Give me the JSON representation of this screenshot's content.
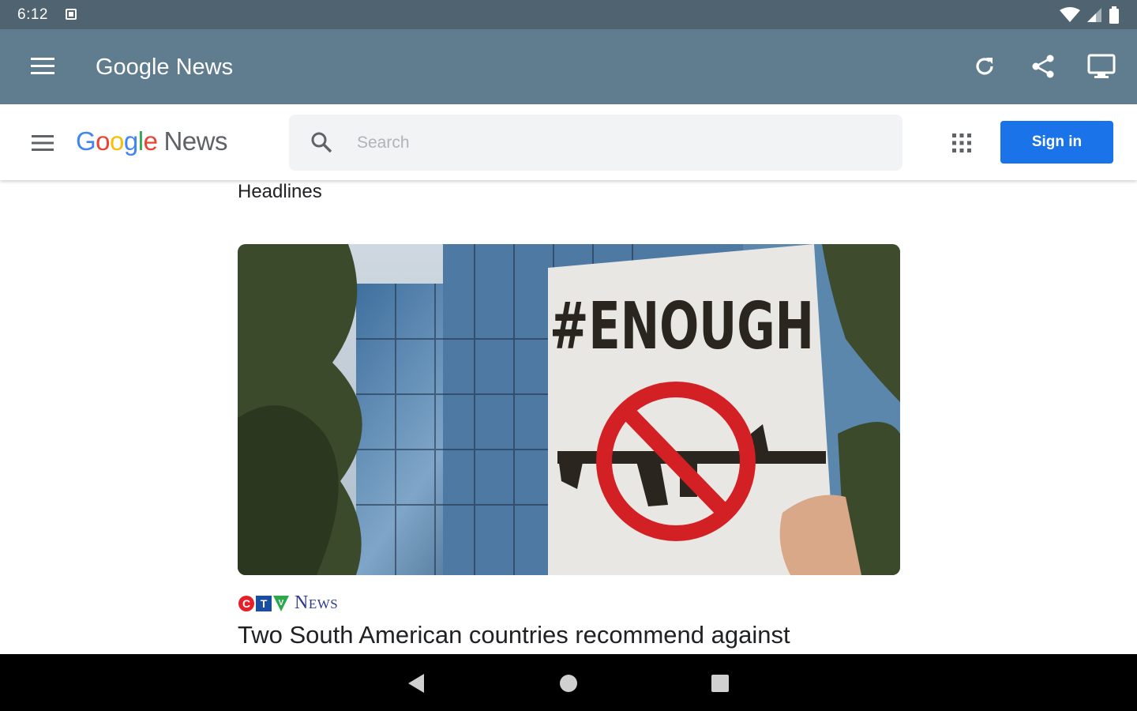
{
  "status_bar": {
    "time": "6:12"
  },
  "app_bar": {
    "title": "Google News"
  },
  "gn_header": {
    "logo_word": [
      "G",
      "o",
      "o",
      "g",
      "l",
      "e"
    ],
    "logo_colors": [
      "#4285f4",
      "#ea4335",
      "#fbbc05",
      "#4285f4",
      "#34a853",
      "#ea4335"
    ],
    "logo_news": "News",
    "search_placeholder": "Search",
    "sign_in_label": "Sign in"
  },
  "main": {
    "section_title": "Headlines",
    "article": {
      "image_sign_text": "#ENOUGH",
      "source_letters": [
        "C",
        "T",
        "V"
      ],
      "source_colors": [
        "#e4202a",
        "#1a4ea2",
        "#2aa84a"
      ],
      "source_news": "News",
      "headline": "Two South American countries recommend against"
    }
  },
  "colors": {
    "status_bar": "#4f6470",
    "app_bar": "#607d8f",
    "sign_in": "#1a73e8"
  }
}
